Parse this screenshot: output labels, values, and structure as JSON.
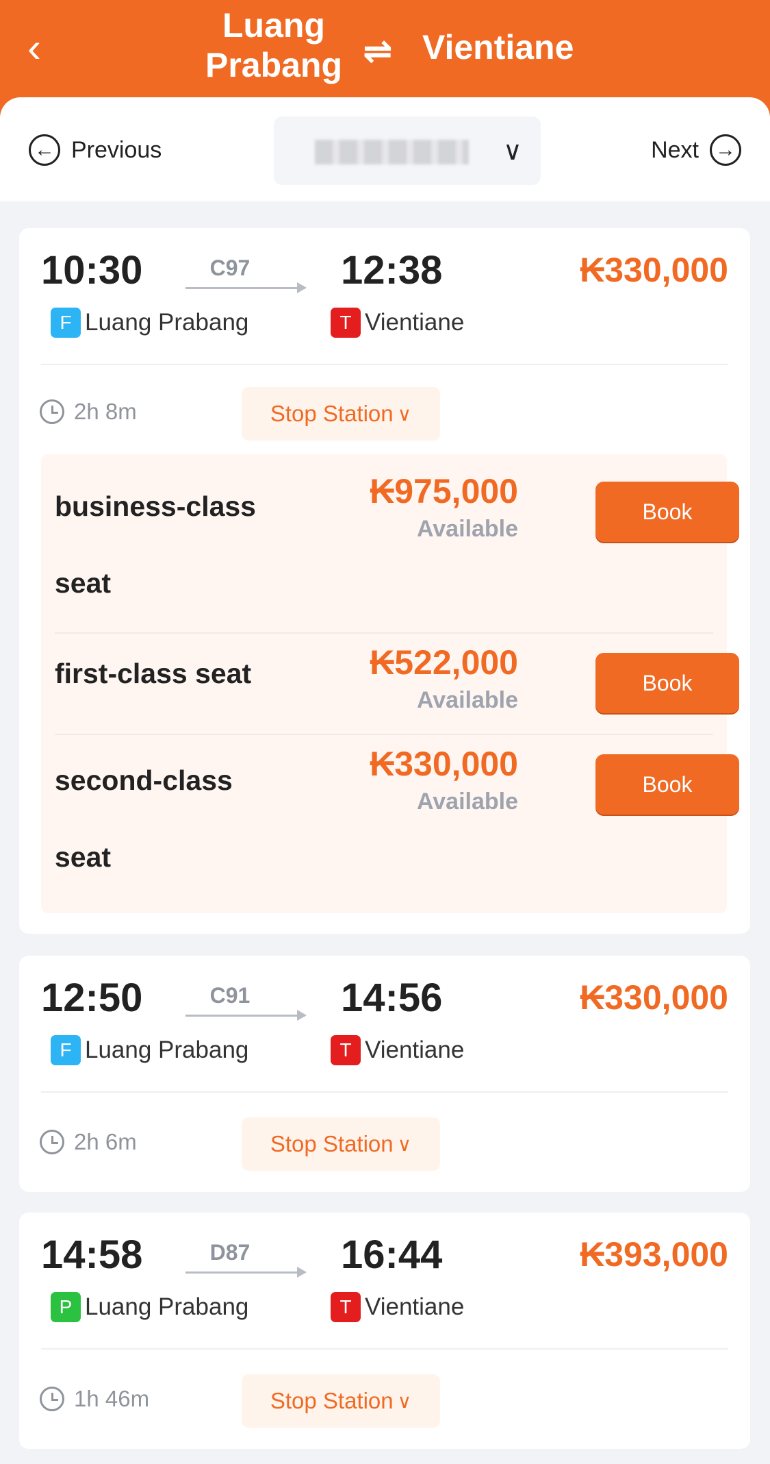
{
  "header": {
    "from": "Luang Prabang",
    "swap_icon": "⇌",
    "to": "Vientiane",
    "back_icon": "‹"
  },
  "datebar": {
    "previous": "Previous",
    "next": "Next",
    "date_value": "",
    "dropdown_icon": "chevron-down"
  },
  "currency": "₭",
  "trains": [
    {
      "depart": "10:30",
      "arrive": "12:38",
      "train_no": "C97",
      "price": "₭330,000",
      "from_badge": "F",
      "from_badge_color": "#2db4f4",
      "from_station": "Luang Prabang",
      "to_badge": "T",
      "to_badge_color": "#e41e1e",
      "to_station": "Vientiane",
      "duration": "2h 8m",
      "stop_station": "Stop Station",
      "seats": [
        {
          "name": "business-class seat",
          "price": "₭975,000",
          "status": "Available",
          "book": "Book"
        },
        {
          "name": "first-class seat",
          "price": "₭522,000",
          "status": "Available",
          "book": "Book"
        },
        {
          "name": "second-class seat",
          "price": "₭330,000",
          "status": "Available",
          "book": "Book"
        }
      ]
    },
    {
      "depart": "12:50",
      "arrive": "14:56",
      "train_no": "C91",
      "price": "₭330,000",
      "from_badge": "F",
      "from_badge_color": "#2db4f4",
      "from_station": "Luang Prabang",
      "to_badge": "T",
      "to_badge_color": "#e41e1e",
      "to_station": "Vientiane",
      "duration": "2h 6m",
      "stop_station": "Stop Station"
    },
    {
      "depart": "14:58",
      "arrive": "16:44",
      "train_no": "D87",
      "price": "₭393,000",
      "from_badge": "P",
      "from_badge_color": "#2ac240",
      "from_station": "Luang Prabang",
      "to_badge": "T",
      "to_badge_color": "#e41e1e",
      "to_station": "Vientiane",
      "duration": "1h 46m",
      "stop_station": "Stop Station"
    }
  ],
  "colors": {
    "accent": "#f06a24",
    "background": "#f2f3f7"
  }
}
